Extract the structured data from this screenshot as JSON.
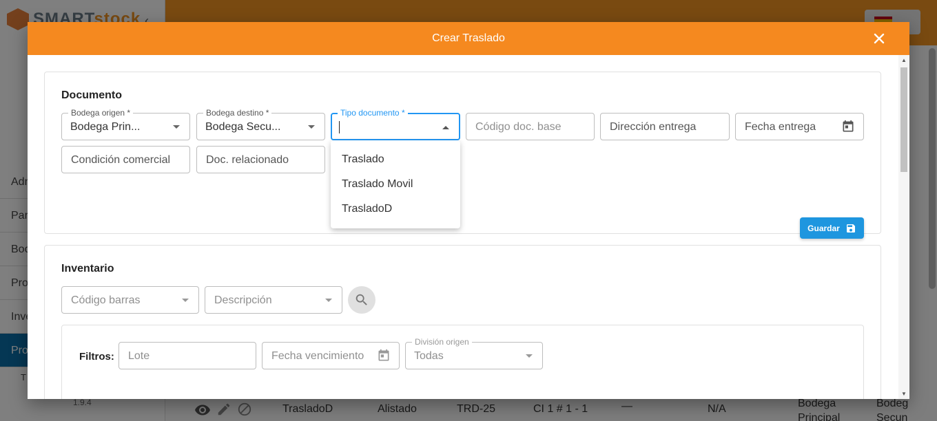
{
  "app": {
    "brand_part1": "SMART",
    "brand_part2": "stock",
    "version": "1.9.4",
    "nav_items": [
      "Adm",
      "Par",
      "Boo",
      "Pro",
      "Inve",
      "Pro",
      "T"
    ],
    "bg_row": {
      "name": "TrasladoD",
      "status": "Alistado",
      "code": "TRD-25",
      "id": "CI 1 # 1 - 1",
      "dash": "—",
      "na": "N/A",
      "origin": "Bodega Principal",
      "dest": "Bodeg Secun"
    }
  },
  "dialog": {
    "title": "Crear Traslado",
    "accent": "#f5891f"
  },
  "documento": {
    "title": "Documento",
    "bodega_origen": {
      "label": "Bodega origen *",
      "value": "Bodega Prin..."
    },
    "bodega_destino": {
      "label": "Bodega destino *",
      "value": "Bodega Secu..."
    },
    "tipo_documento": {
      "label": "Tipo documento *",
      "value": ""
    },
    "codigo_doc_base": {
      "placeholder": "Código doc. base"
    },
    "direccion_entrega": {
      "placeholder": "Dirección entrega"
    },
    "fecha_entrega": {
      "placeholder": "Fecha entrega"
    },
    "condicion_comercial": {
      "placeholder": "Condición comercial"
    },
    "doc_relacionado": {
      "placeholder": "Doc. relacionado"
    },
    "tipo_options": [
      "Traslado",
      "Traslado Movil",
      "TrasladoD"
    ],
    "save_label": "Guardar"
  },
  "inventario": {
    "title": "Inventario",
    "codigo_barras": {
      "placeholder": "Código barras"
    },
    "descripcion": {
      "placeholder": "Descripción"
    },
    "filters_label": "Filtros:",
    "lote": {
      "placeholder": "Lote"
    },
    "fecha_vencimiento": {
      "placeholder": "Fecha vencimiento"
    },
    "division_origen": {
      "label": "División origen",
      "value": "Todas"
    }
  }
}
